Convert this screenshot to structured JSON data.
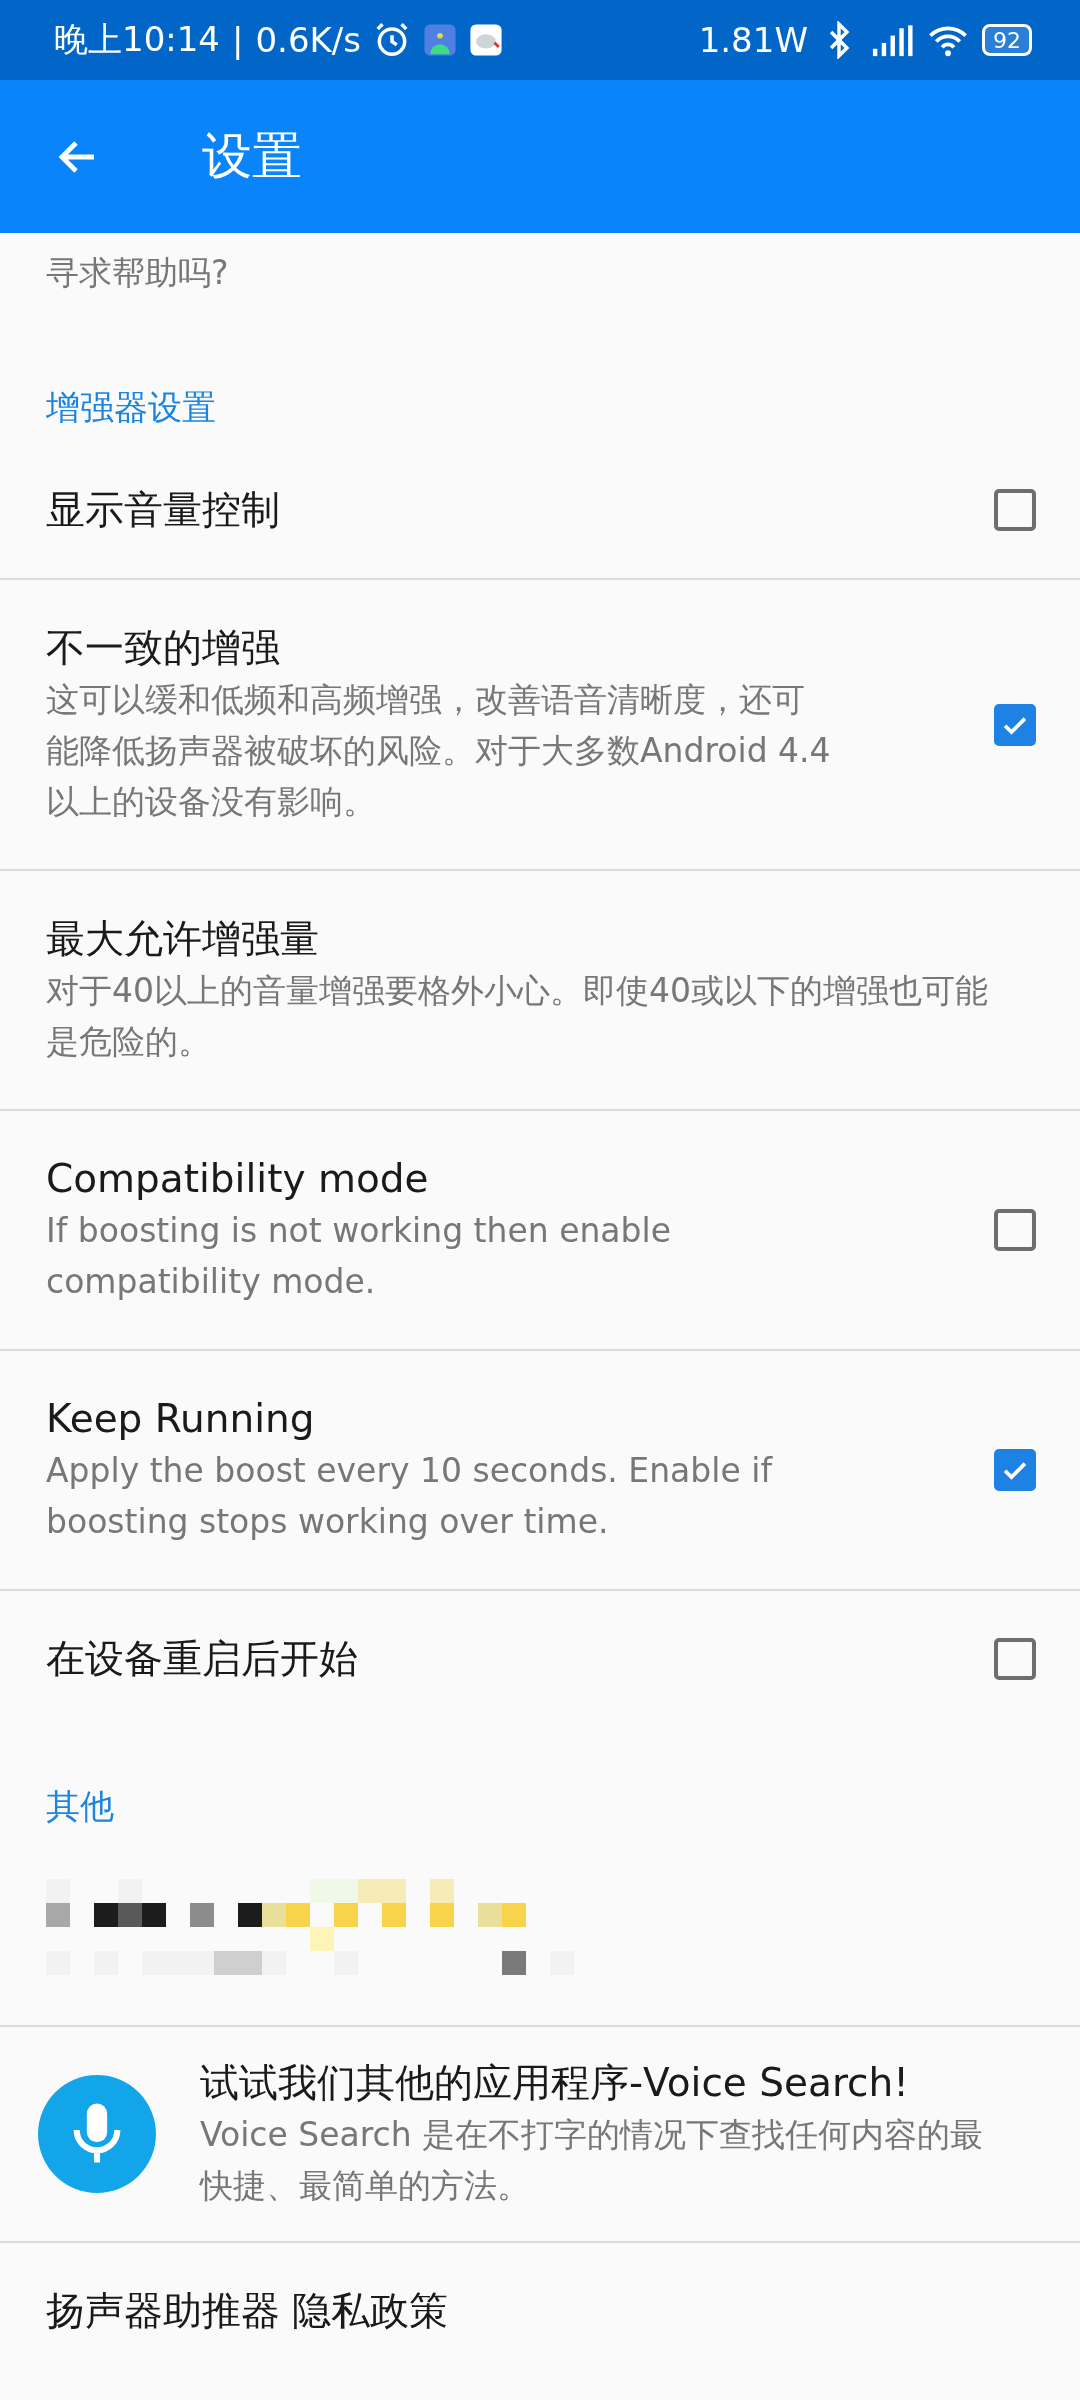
{
  "status_bar": {
    "time": "晚上10:14",
    "separator": "|",
    "speed": "0.6K/s",
    "power": "1.81W",
    "battery": "92"
  },
  "app_bar": {
    "title": "设置"
  },
  "items": [
    {
      "kind": "summary_only",
      "summary": "寻求帮助吗?"
    },
    {
      "kind": "category",
      "title": "增强器设置"
    },
    {
      "kind": "checkbox",
      "title": "显示音量控制",
      "checked": false
    },
    {
      "kind": "checkbox",
      "title": "不一致的增强",
      "summary": "这可以缓和低频和高频增强，改善语音清晰度，还可能降低扬声器被破坏的风险。对于大多数Android 4.4以上的设备没有影响。",
      "checked": true
    },
    {
      "kind": "plain",
      "title": "最大允许增强量",
      "summary": "对于40以上的音量增强要格外小心。即使40或以下的增强也可能是危险的。"
    },
    {
      "kind": "checkbox",
      "title": "Compatibility mode",
      "summary": "If boosting is not working then enable compatibility mode.",
      "checked": false
    },
    {
      "kind": "checkbox",
      "title": "Keep Running",
      "summary": "Apply the boost every 10 seconds. Enable if boosting stops working over time.",
      "checked": true
    },
    {
      "kind": "checkbox",
      "title": "在设备重启后开始",
      "checked": false
    },
    {
      "kind": "category",
      "title": "其他"
    },
    {
      "kind": "picture"
    },
    {
      "kind": "promo",
      "title": "试试我们其他的应用程序-Voice Search!",
      "summary": "Voice Search 是在不打字的情况下查找任何内容的最快捷、最简单的方法。"
    },
    {
      "kind": "plain",
      "title": "扬声器助推器 隐私政策"
    }
  ]
}
